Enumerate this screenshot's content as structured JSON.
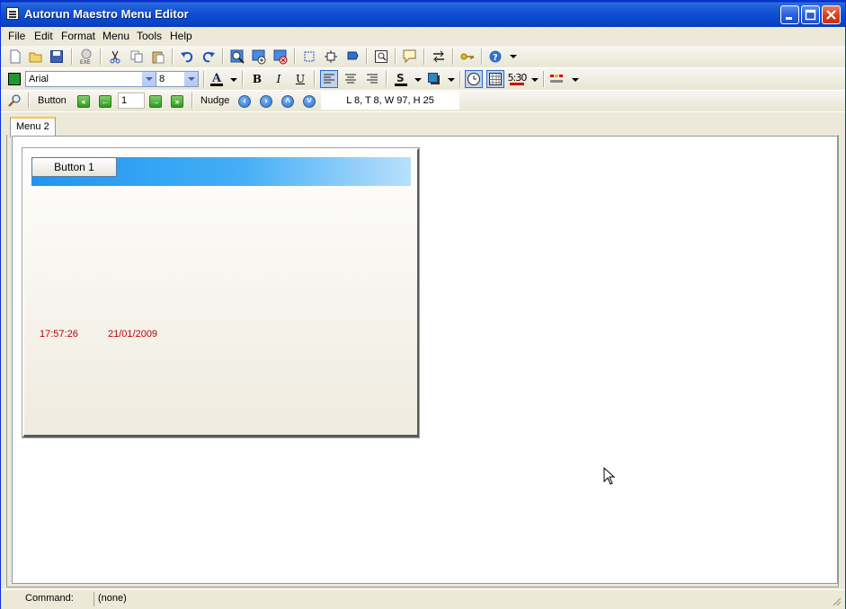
{
  "window": {
    "title": "Autorun Maestro Menu Editor"
  },
  "menubar": {
    "items": [
      "File",
      "Edit",
      "Format",
      "Menu",
      "Tools",
      "Help"
    ]
  },
  "format_toolbar": {
    "font_name": "Arial",
    "font_size": "8",
    "bold": "B",
    "italic": "I",
    "underline": "U",
    "time_label": "5:30"
  },
  "nav_toolbar": {
    "object_type": "Button",
    "index_value": "1",
    "nudge_label": "Nudge",
    "position_readout": "L 8, T 8, W 97, H 25"
  },
  "tabs": [
    {
      "label": "Menu 2"
    }
  ],
  "menu_panel": {
    "button_label": "Button 1",
    "clock_time": "17:57:26",
    "clock_date": "21/01/2009",
    "bar_colors": [
      "#1E96F0",
      "#B8E0FC"
    ],
    "date_color": "#C00000"
  },
  "statusbar": {
    "label": "Command:",
    "value": "(none)"
  },
  "icons": {
    "toolbar1": [
      "new-file-icon",
      "open-folder-icon",
      "save-icon",
      "build-exe-icon",
      "cut-icon",
      "copy-icon",
      "paste-icon",
      "undo-icon",
      "redo-icon",
      "preview-icon",
      "add-page-icon",
      "delete-page-icon",
      "select-grid-icon",
      "snap-icon",
      "flag-icon",
      "image-icon",
      "speech-bubble-icon",
      "link-icon",
      "key-icon",
      "help-icon"
    ],
    "toolbar2": [
      "fill-color-icon",
      "font-color-icon",
      "align-left-icon",
      "align-center-icon",
      "align-right-icon",
      "text-shadow-icon",
      "shadow-icon",
      "clock-icon",
      "calendar-icon",
      "time-format-icon",
      "color-palette-icon"
    ],
    "toolbar3": [
      "zoom-icon",
      "first-icon",
      "prev-icon",
      "next-icon",
      "last-icon",
      "nudge-left-icon",
      "nudge-right-icon",
      "nudge-up-icon",
      "nudge-down-icon"
    ]
  }
}
